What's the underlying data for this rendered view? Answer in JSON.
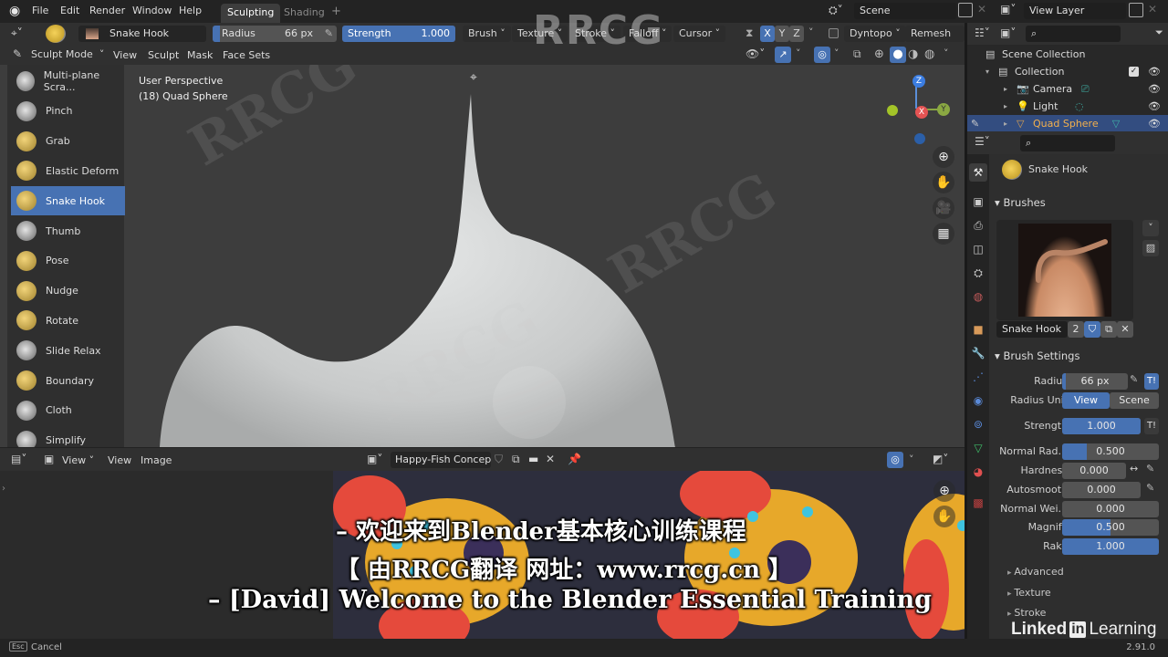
{
  "topbar": {
    "menus": [
      "File",
      "Edit",
      "Render",
      "Window",
      "Help"
    ],
    "workspace_tabs": [
      {
        "label": "Sculpting",
        "active": true
      },
      {
        "label": "Shading",
        "active": false
      }
    ],
    "add_tab_label": "+",
    "scene_label": "Scene",
    "view_layer_label": "View Layer"
  },
  "tool_header": {
    "brush_name": "Snake Hook",
    "radius_label": "Radius",
    "radius_value": "66 px",
    "strength_label": "Strength",
    "strength_value": "1.000",
    "dropdowns": [
      "Brush",
      "Texture",
      "Stroke",
      "Falloff",
      "Cursor"
    ],
    "symmetry_axes": [
      {
        "label": "X",
        "active": true
      },
      {
        "label": "Y",
        "active": false
      },
      {
        "label": "Z",
        "active": false
      }
    ],
    "dyntopo_label": "Dyntopo",
    "remesh_label": "Remesh"
  },
  "mode_header": {
    "mode_label": "Sculpt Mode",
    "menus": [
      "View",
      "Sculpt",
      "Mask",
      "Face Sets"
    ]
  },
  "viewport": {
    "perspective_label": "User Perspective",
    "object_label": "(18) Quad Sphere",
    "gizmo_axes": [
      "Z",
      "Y",
      "X"
    ]
  },
  "tools": [
    {
      "label": "Multi-plane Scra...",
      "active": false,
      "gold": false
    },
    {
      "label": "Pinch",
      "active": false,
      "gold": false
    },
    {
      "label": "Grab",
      "active": false,
      "gold": true
    },
    {
      "label": "Elastic Deform",
      "active": false,
      "gold": true
    },
    {
      "label": "Snake Hook",
      "active": true,
      "gold": true
    },
    {
      "label": "Thumb",
      "active": false,
      "gold": false
    },
    {
      "label": "Pose",
      "active": false,
      "gold": true
    },
    {
      "label": "Nudge",
      "active": false,
      "gold": true
    },
    {
      "label": "Rotate",
      "active": false,
      "gold": true
    },
    {
      "label": "Slide Relax",
      "active": false,
      "gold": false
    },
    {
      "label": "Boundary",
      "active": false,
      "gold": true
    },
    {
      "label": "Cloth",
      "active": false,
      "gold": false
    },
    {
      "label": "Simplify",
      "active": false,
      "gold": false
    }
  ],
  "image_editor": {
    "menus": [
      "View",
      "View",
      "Image"
    ],
    "image_name": "Happy-Fish Concept..."
  },
  "outliner": {
    "root": "Scene Collection",
    "items": [
      {
        "label": "Collection",
        "indent": 1,
        "selected": false,
        "checkbox": true
      },
      {
        "label": "Camera",
        "indent": 2,
        "selected": false
      },
      {
        "label": "Light",
        "indent": 2,
        "selected": false
      },
      {
        "label": "Quad Sphere",
        "indent": 2,
        "selected": true
      }
    ]
  },
  "properties": {
    "brush_title": "Snake Hook",
    "brushes_panel": "Brushes",
    "brush_datablock_name": "Snake Hook",
    "brush_users": "2",
    "brush_settings_panel": "Brush Settings",
    "radius": {
      "label": "Radius",
      "value": "66 px",
      "fill": 0.05
    },
    "radius_unit": {
      "label": "Radius Unit",
      "options": [
        "View",
        "Scene"
      ],
      "selected": "View"
    },
    "strength": {
      "label": "Strength",
      "value": "1.000",
      "fill": 1.0
    },
    "normal_radius": {
      "label": "Normal Rad...",
      "value": "0.500",
      "fill": 0.25
    },
    "hardness": {
      "label": "Hardness",
      "value": "0.000",
      "fill": 0.0
    },
    "autosmooth": {
      "label": "Autosmooth",
      "value": "0.000",
      "fill": 0.0
    },
    "normal_weight": {
      "label": "Normal Wei...",
      "value": "0.000",
      "fill": 0.0
    },
    "magnify": {
      "label": "Magnify",
      "value": "0.500",
      "fill": 0.5
    },
    "rake": {
      "label": "Rake",
      "value": "1.000",
      "fill": 1.0
    },
    "subpanels": [
      "Advanced",
      "Texture",
      "Stroke"
    ]
  },
  "subtitles": {
    "line1": "– 欢迎来到Blender基本核心训练课程",
    "line2": "【 由RRCG翻译 网址：www.rrcg.cn 】",
    "line3": "– [David] Welcome to the Blender Essential Training"
  },
  "branding": {
    "linkedin_pre": "Linked",
    "linkedin_in": "in",
    "linkedin_post": "Learning",
    "watermark_logo": "RRCG"
  },
  "statusbar": {
    "key_label": "Esc",
    "action_label": "Cancel",
    "version": "2.91.0"
  },
  "colors": {
    "accent": "#4772b3",
    "selected_row": "#334d80",
    "panel_bg": "#303030"
  }
}
